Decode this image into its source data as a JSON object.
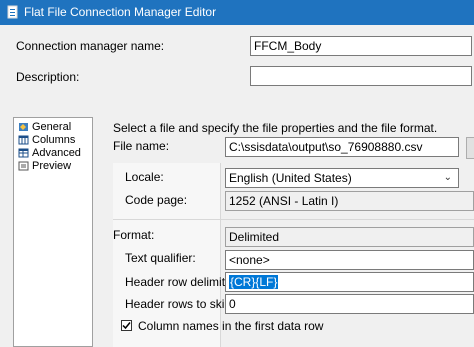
{
  "window": {
    "title": "Flat File Connection Manager Editor"
  },
  "header": {
    "cm_name_label": "Connection manager name:",
    "cm_name_value": "FFCM_Body",
    "description_label": "Description:",
    "description_value": ""
  },
  "nav": {
    "items": [
      {
        "label": "General",
        "icon": "general-icon"
      },
      {
        "label": "Columns",
        "icon": "columns-icon"
      },
      {
        "label": "Advanced",
        "icon": "advanced-icon"
      },
      {
        "label": "Preview",
        "icon": "preview-icon"
      }
    ]
  },
  "general": {
    "instruction": "Select a file and specify the file properties and the file format.",
    "file_name_label": "File name:",
    "file_name_value": "C:\\ssisdata\\output\\so_76908880.csv",
    "locale_label": "Locale:",
    "locale_value": "English (United States)",
    "code_page_label": "Code page:",
    "code_page_value": "1252  (ANSI - Latin I)",
    "format_label": "Format:",
    "format_value": "Delimited",
    "text_qualifier_label": "Text qualifier:",
    "text_qualifier_value": "<none>",
    "header_delim_label": "Header row delimiter:",
    "header_delim_value": "{CR}{LF}",
    "header_skip_label": "Header rows to skip:",
    "header_skip_value": "0",
    "col_names_label": "Column names in the first data row",
    "col_names_checked": true
  },
  "colors": {
    "titlebar": "#1f73bf",
    "selection": "#0078d7"
  }
}
